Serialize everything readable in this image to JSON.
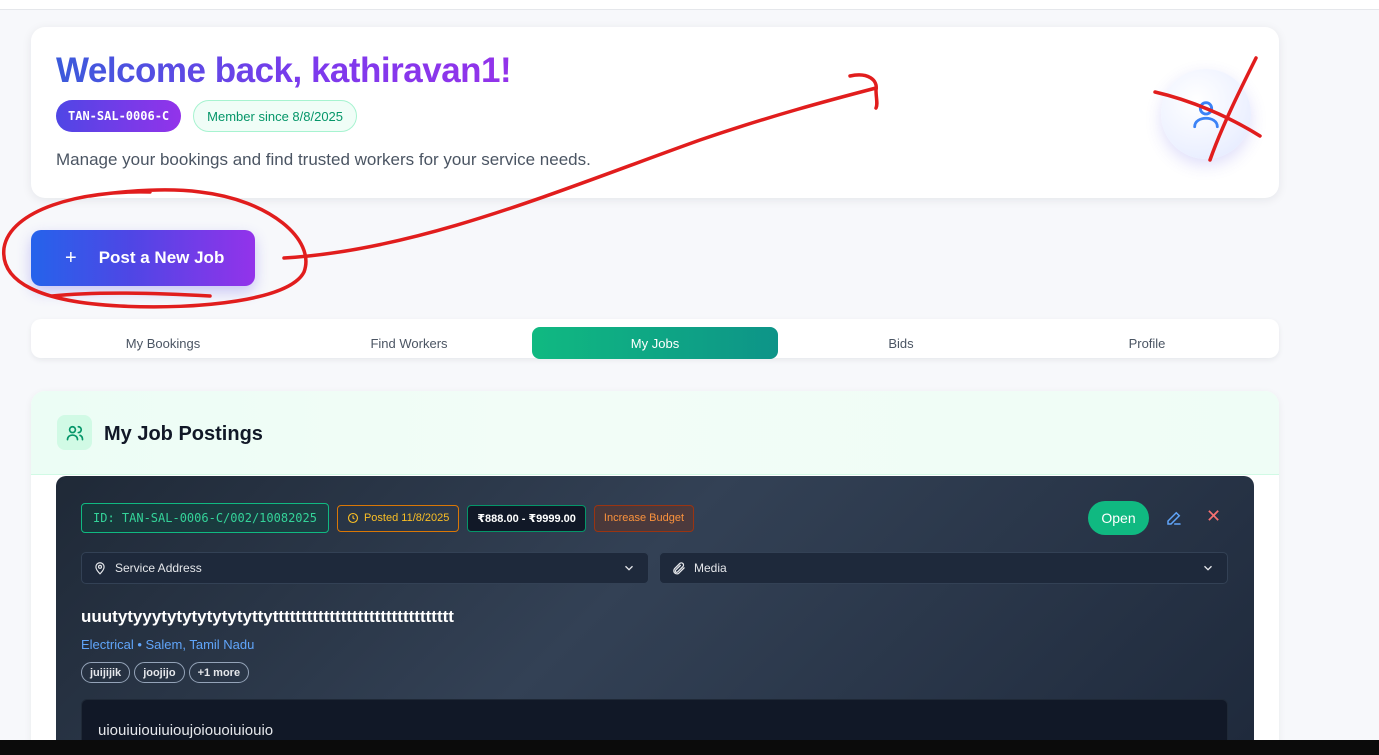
{
  "header": {
    "welcome_title": "Welcome back, kathiravan1!",
    "user_code": "TAN-SAL-0006-C",
    "member_since": "Member since 8/8/2025",
    "subtitle": "Manage your bookings and find trusted workers for your service needs.",
    "avatar_icon": "user-icon"
  },
  "actions": {
    "post_job_label": "Post a New Job",
    "post_job_icon": "plus-icon"
  },
  "tabs": [
    {
      "label": "My Bookings",
      "active": false
    },
    {
      "label": "Find Workers",
      "active": false
    },
    {
      "label": "My Jobs",
      "active": true
    },
    {
      "label": "Bids",
      "active": false
    },
    {
      "label": "Profile",
      "active": false
    }
  ],
  "postings": {
    "title": "My Job Postings",
    "icon": "users-icon",
    "job": {
      "id": "ID: TAN-SAL-0006-C/002/10082025",
      "posted": "Posted 11/8/2025",
      "price_range": "₹888.00 - ₹9999.00",
      "increase_budget": "Increase Budget",
      "status": "Open",
      "service_address_label": "Service Address",
      "media_label": "Media",
      "title": "uuutytyyytytytytytytyttytttttttttttttttttttttttttttttttt",
      "category_location": "Electrical • Salem, Tamil Nadu",
      "tags": [
        "juijijik",
        "joojijo",
        "+1 more"
      ],
      "description": "uiouiuiouiuioujoiouoiuiouio"
    }
  },
  "colors": {
    "accent_green": "#10b981",
    "accent_purple": "#9333ea",
    "accent_blue": "#2563eb",
    "annotation_red": "#e11d1d"
  }
}
